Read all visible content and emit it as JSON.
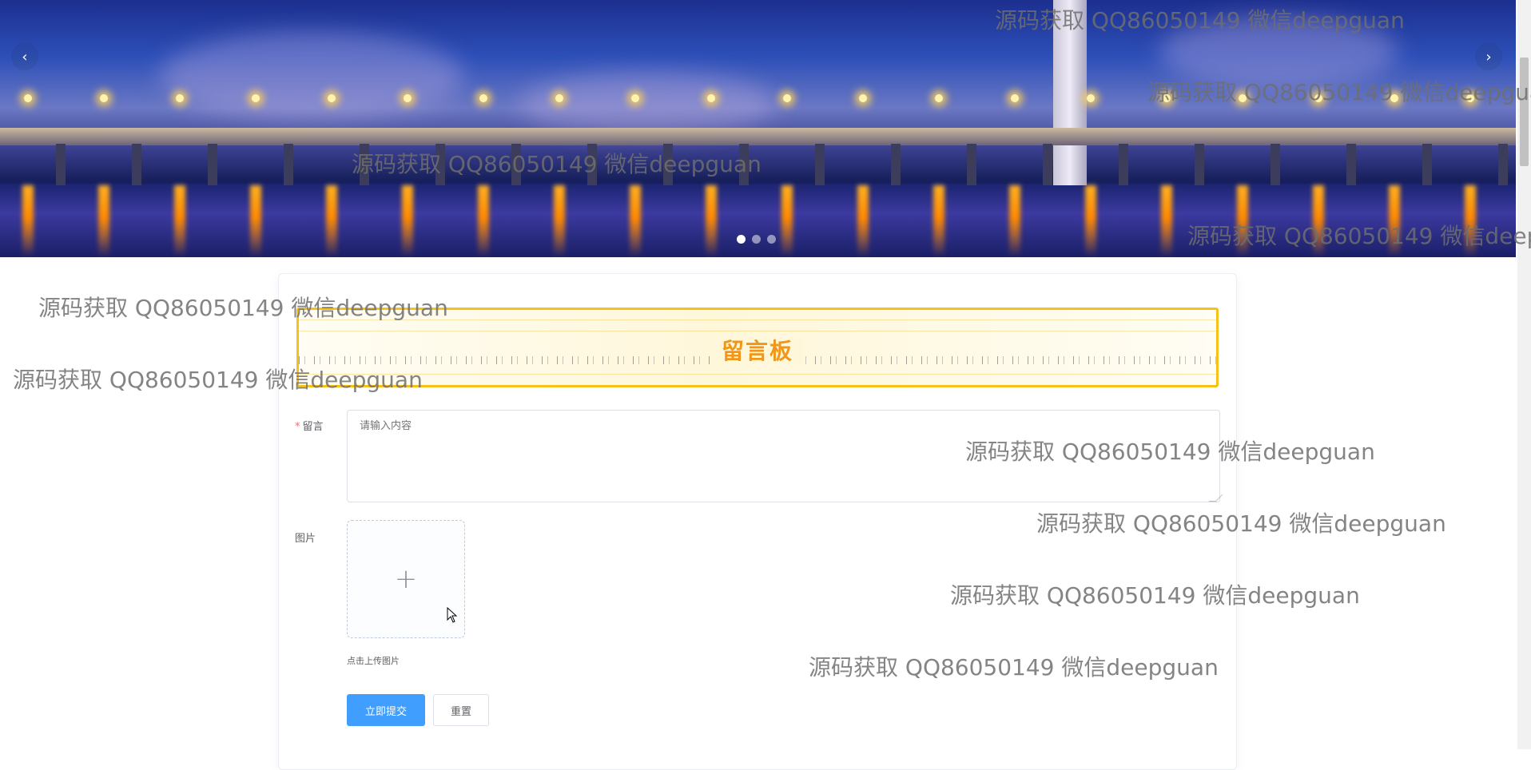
{
  "carousel": {
    "prev_label": "‹",
    "next_label": "›",
    "slide_count": 3,
    "active_index": 0
  },
  "form": {
    "banner_title": "留言板",
    "message_label": "留言",
    "message_required": "*",
    "message_placeholder": "请输入内容",
    "image_label": "图片",
    "upload_plus": "+",
    "upload_tip": "点击上传图片",
    "submit_label": "立即提交",
    "reset_label": "重置"
  },
  "watermark_text": "源码获取 QQ86050149 微信deepguan",
  "colors": {
    "primary": "#409eff",
    "banner_title": "#f0961a",
    "banner_border": "#f3c21b",
    "required": "#f56c6c"
  }
}
